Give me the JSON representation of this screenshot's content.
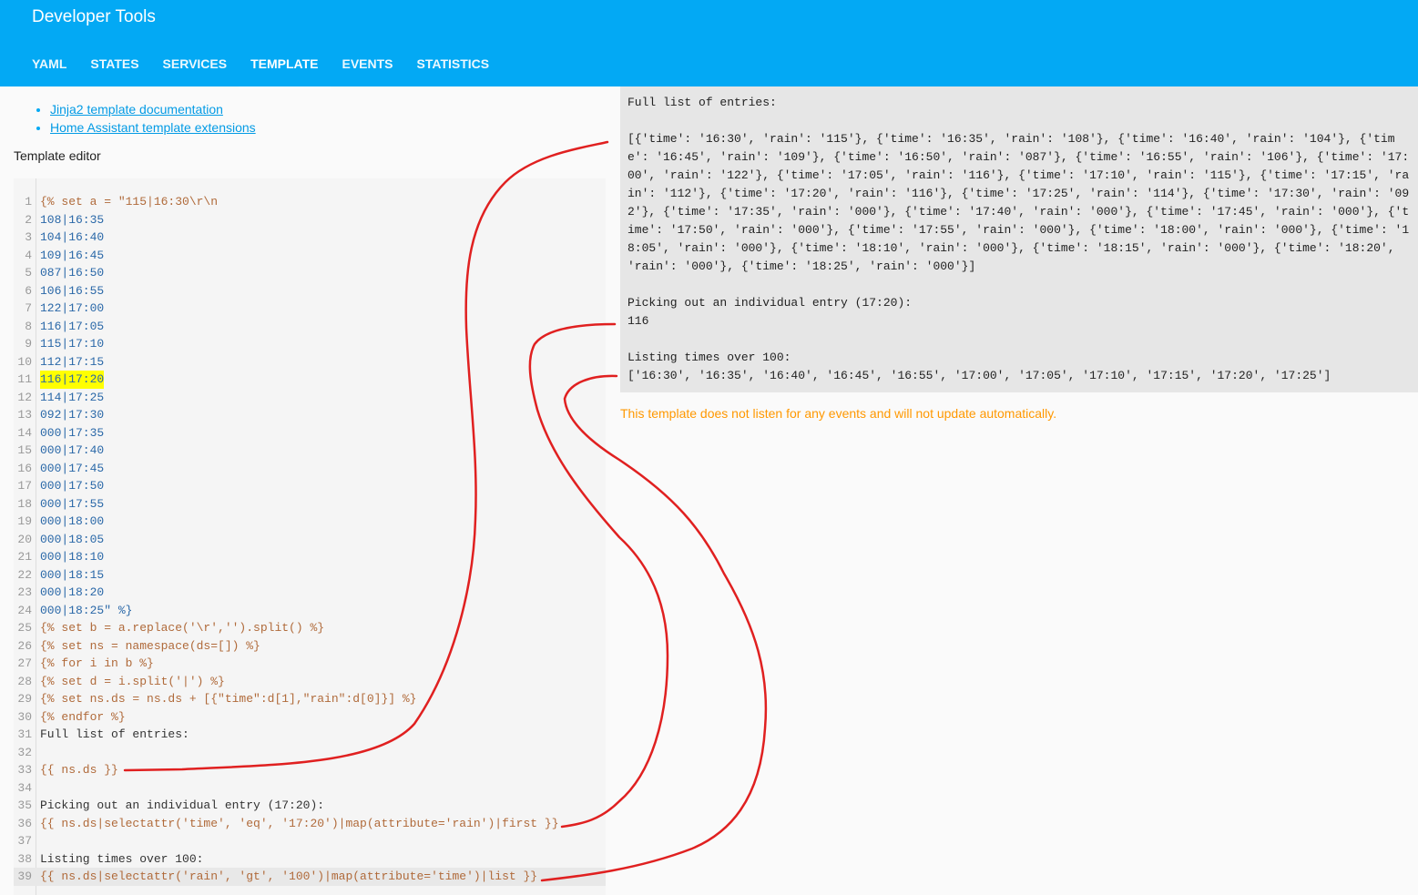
{
  "app": {
    "title": "Developer Tools"
  },
  "tabs": [
    {
      "label": "YAML",
      "active": false
    },
    {
      "label": "STATES",
      "active": false
    },
    {
      "label": "SERVICES",
      "active": false
    },
    {
      "label": "TEMPLATE",
      "active": true
    },
    {
      "label": "EVENTS",
      "active": false
    },
    {
      "label": "STATISTICS",
      "active": false
    }
  ],
  "links": [
    {
      "label": "Jinja2 template documentation"
    },
    {
      "label": "Home Assistant template extensions"
    }
  ],
  "editor": {
    "label": "Template editor",
    "highlighted_line": 11,
    "lines": [
      {
        "n": "1",
        "text": "{% set a = \"115|16:30\\r\\n"
      },
      {
        "n": "2",
        "text": "108|16:35"
      },
      {
        "n": "3",
        "text": "104|16:40"
      },
      {
        "n": "4",
        "text": "109|16:45"
      },
      {
        "n": "5",
        "text": "087|16:50"
      },
      {
        "n": "6",
        "text": "106|16:55"
      },
      {
        "n": "7",
        "text": "122|17:00"
      },
      {
        "n": "8",
        "text": "116|17:05"
      },
      {
        "n": "9",
        "text": "115|17:10"
      },
      {
        "n": "10",
        "text": "112|17:15"
      },
      {
        "n": "11",
        "text": "116|17:20"
      },
      {
        "n": "12",
        "text": "114|17:25"
      },
      {
        "n": "13",
        "text": "092|17:30"
      },
      {
        "n": "14",
        "text": "000|17:35"
      },
      {
        "n": "15",
        "text": "000|17:40"
      },
      {
        "n": "16",
        "text": "000|17:45"
      },
      {
        "n": "17",
        "text": "000|17:50"
      },
      {
        "n": "18",
        "text": "000|17:55"
      },
      {
        "n": "19",
        "text": "000|18:00"
      },
      {
        "n": "20",
        "text": "000|18:05"
      },
      {
        "n": "21",
        "text": "000|18:10"
      },
      {
        "n": "22",
        "text": "000|18:15"
      },
      {
        "n": "23",
        "text": "000|18:20"
      },
      {
        "n": "24",
        "text": "000|18:25\" %}"
      },
      {
        "n": "25",
        "text": "{% set b = a.replace('\\r','').split() %}"
      },
      {
        "n": "26",
        "text": "{% set ns = namespace(ds=[]) %}"
      },
      {
        "n": "27",
        "text": "{% for i in b %}"
      },
      {
        "n": "28",
        "text": "{% set d = i.split('|') %}"
      },
      {
        "n": "29",
        "text": "{% set ns.ds = ns.ds + [{\"time\":d[1],\"rain\":d[0]}] %}"
      },
      {
        "n": "30",
        "text": "{% endfor %}"
      },
      {
        "n": "31",
        "text": "Full list of entries:"
      },
      {
        "n": "32",
        "text": ""
      },
      {
        "n": "33",
        "text": "{{ ns.ds }}"
      },
      {
        "n": "34",
        "text": ""
      },
      {
        "n": "35",
        "text": "Picking out an individual entry (17:20):"
      },
      {
        "n": "36",
        "text": "{{ ns.ds|selectattr('time', 'eq', '17:20')|map(attribute='rain')|first }}"
      },
      {
        "n": "37",
        "text": ""
      },
      {
        "n": "38",
        "text": "Listing times over 100:"
      },
      {
        "n": "39",
        "text": "{{ ns.ds|selectattr('rain', 'gt', '100')|map(attribute='time')|list }}"
      }
    ]
  },
  "output": {
    "full_list_heading": "Full list of entries:",
    "full_list_value": "[{'time': '16:30', 'rain': '115'}, {'time': '16:35', 'rain': '108'}, {'time': '16:40', 'rain': '104'}, {'time': '16:45', 'rain': '109'}, {'time': '16:50', 'rain': '087'}, {'time': '16:55', 'rain': '106'}, {'time': '17:00', 'rain': '122'}, {'time': '17:05', 'rain': '116'}, {'time': '17:10', 'rain': '115'}, {'time': '17:15', 'rain': '112'}, {'time': '17:20', 'rain': '116'}, {'time': '17:25', 'rain': '114'}, {'time': '17:30', 'rain': '092'}, {'time': '17:35', 'rain': '000'}, {'time': '17:40', 'rain': '000'}, {'time': '17:45', 'rain': '000'}, {'time': '17:50', 'rain': '000'}, {'time': '17:55', 'rain': '000'}, {'time': '18:00', 'rain': '000'}, {'time': '18:05', 'rain': '000'}, {'time': '18:10', 'rain': '000'}, {'time': '18:15', 'rain': '000'}, {'time': '18:20', 'rain': '000'}, {'time': '18:25', 'rain': '000'}]",
    "single_heading": "Picking out an individual entry (17:20):",
    "single_value": "116",
    "list_heading": "Listing times over 100:",
    "list_value": "['16:30', '16:35', '16:40', '16:45', '16:55', '17:00', '17:05', '17:10', '17:15', '17:20', '17:25']"
  },
  "notice": "This template does not listen for any events and will not update automatically.",
  "colors": {
    "header": "#03a9f4",
    "notice": "#ff9800",
    "annotation": "#e02020",
    "highlight": "#ffff00"
  }
}
